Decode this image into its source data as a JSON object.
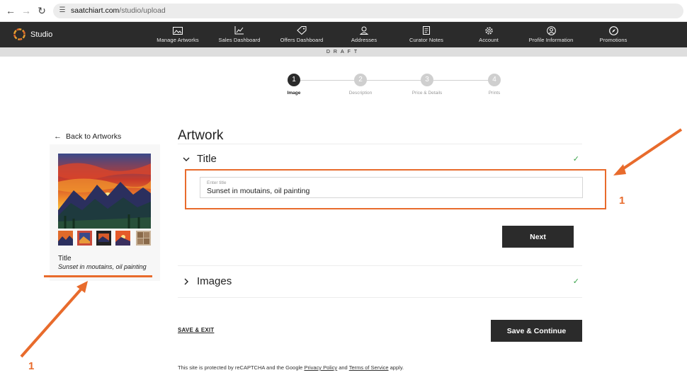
{
  "browser": {
    "url_host": "saatchiart.com",
    "url_path": "/studio/upload"
  },
  "studio": {
    "brand": "Studio",
    "menu": [
      {
        "label": "Manage Artworks",
        "icon": "image-icon"
      },
      {
        "label": "Sales Dashboard",
        "icon": "chart-icon"
      },
      {
        "label": "Offers Dashboard",
        "icon": "tag-icon"
      },
      {
        "label": "Addresses",
        "icon": "location-icon"
      },
      {
        "label": "Curator Notes",
        "icon": "notes-icon"
      },
      {
        "label": "Account",
        "icon": "gear-icon"
      },
      {
        "label": "Profile Information",
        "icon": "user-icon"
      },
      {
        "label": "Promotions",
        "icon": "compass-icon"
      }
    ]
  },
  "draft_label": "DRAFT",
  "steps": [
    {
      "num": "1",
      "label": "Image",
      "active": true
    },
    {
      "num": "2",
      "label": "Description",
      "active": false
    },
    {
      "num": "3",
      "label": "Price & Details",
      "active": false
    },
    {
      "num": "4",
      "label": "Prints",
      "active": false
    }
  ],
  "sidebar": {
    "back_label": "Back to Artworks",
    "title_label": "Title",
    "title_value": "Sunset in moutains, oil painting"
  },
  "main": {
    "heading": "Artwork",
    "title_section": "Title",
    "title_placeholder": "Enter title",
    "title_value": "Sunset in moutains, oil painting",
    "next_label": "Next",
    "images_section": "Images",
    "save_exit_label": "SAVE & EXIT",
    "save_continue_label": "Save & Continue"
  },
  "footer": {
    "prefix": "This site is protected by reCAPTCHA and the Google",
    "privacy": "Privacy Policy",
    "and": "and",
    "terms": "Terms of Service",
    "suffix": "apply."
  },
  "annotations": {
    "right_num": "1",
    "left_num": "1",
    "color": "#e86b2c"
  }
}
